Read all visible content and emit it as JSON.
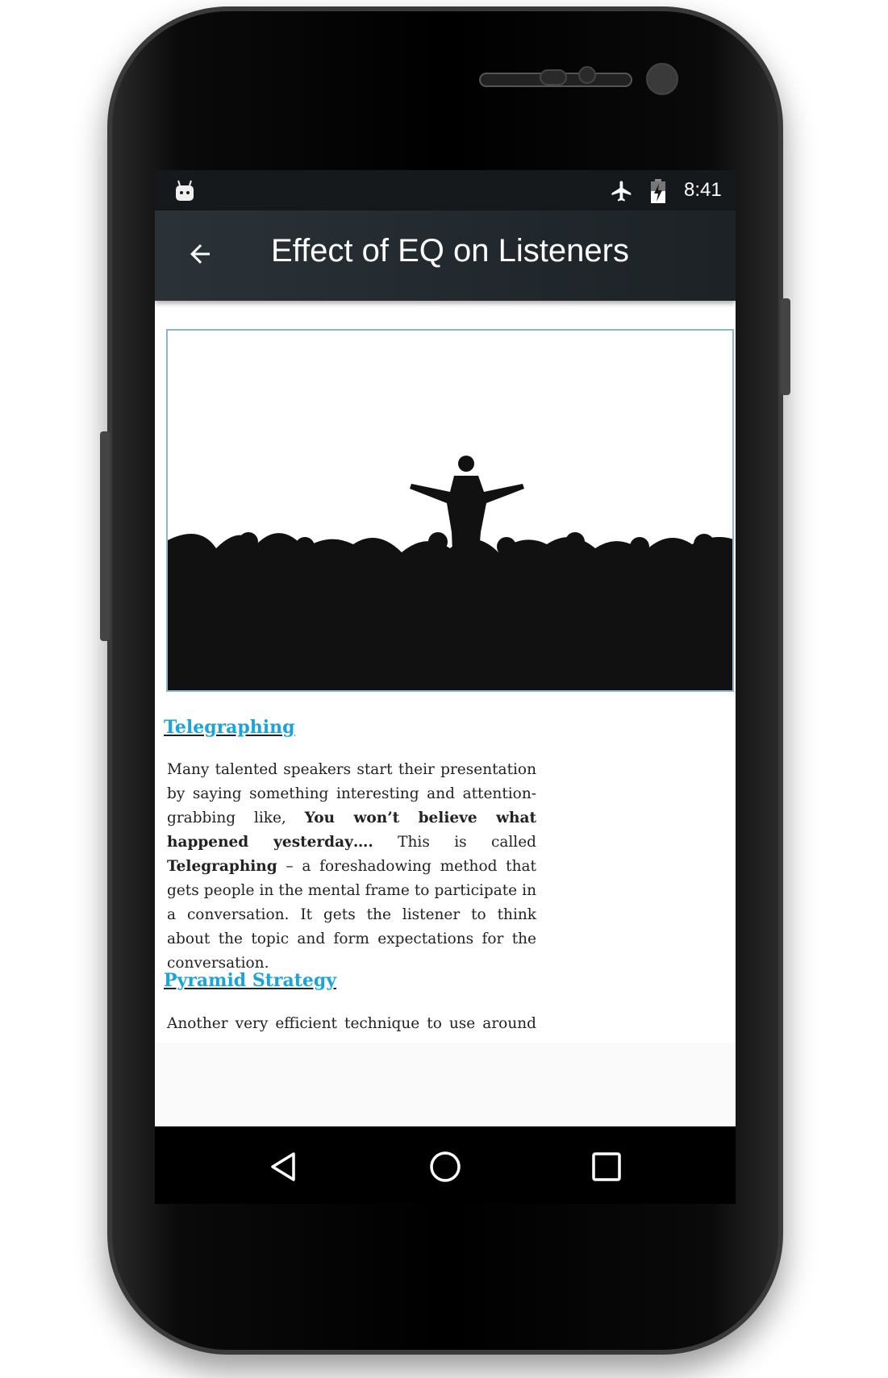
{
  "status_bar": {
    "notification_icon": "android-icon",
    "airplane_icon": "airplane-mode-icon",
    "battery_icon": "battery-charging-icon",
    "time": "8:41"
  },
  "app_bar": {
    "back_icon": "arrow-left-icon",
    "title": "Effect of EQ on Listeners"
  },
  "article": {
    "image_alt": "speaker silhouette in front of audience",
    "sections": [
      {
        "heading": "Telegraphing",
        "p1": "Many talented speakers start their presentation by saying something interesting and attention-grabbing like, ",
        "bold1": "You won’t believe what happened yesterday….",
        "p2": " This is called ",
        "bold2": "Telegraphing",
        "p3": " – a foreshadowing method that gets people in the mental frame to participate in a conversation. It gets the listener to think about the topic and form expectations for the conversation."
      },
      {
        "heading": "Pyramid Strategy",
        "p1": "Another very efficient technique to use around"
      }
    ]
  },
  "nav_bar": {
    "back": "triangle-back-icon",
    "home": "circle-home-icon",
    "recents": "square-recents-icon"
  }
}
